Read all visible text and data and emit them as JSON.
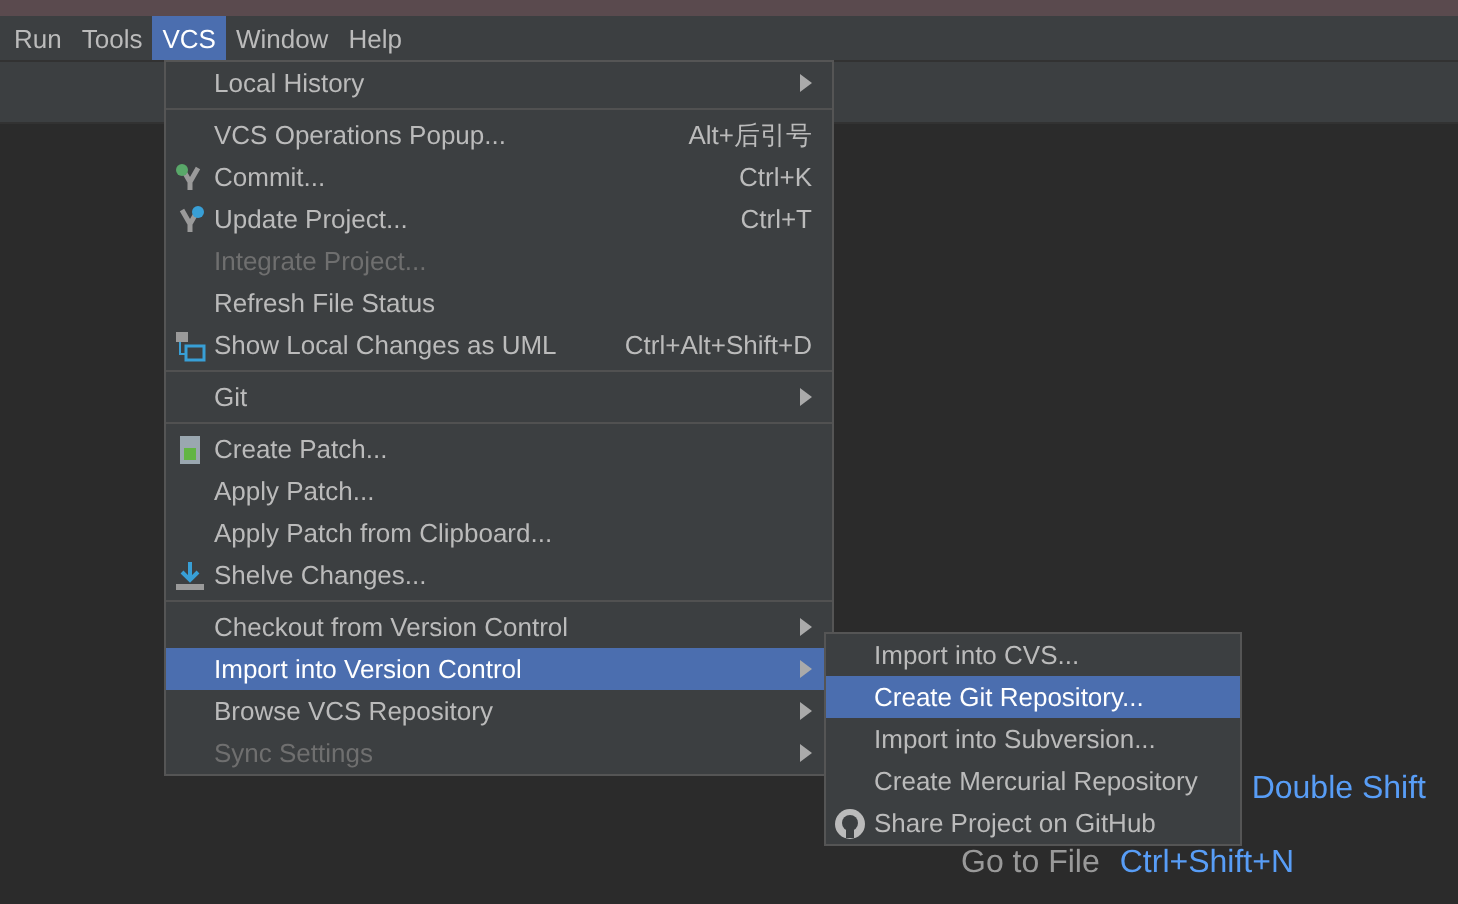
{
  "menubar": [
    {
      "label": "Run",
      "selected": false
    },
    {
      "label": "Tools",
      "selected": false
    },
    {
      "label": "VCS",
      "selected": true
    },
    {
      "label": "Window",
      "selected": false
    },
    {
      "label": "Help",
      "selected": false
    }
  ],
  "menu": [
    {
      "kind": "item",
      "label": "Local History",
      "submenu": true,
      "disabled": false,
      "selected": false
    },
    {
      "kind": "separator"
    },
    {
      "kind": "item",
      "label": "VCS Operations Popup...",
      "shortcut": "Alt+后引号",
      "disabled": false,
      "selected": false
    },
    {
      "kind": "item",
      "label": "Commit...",
      "shortcut": "Ctrl+K",
      "disabled": false,
      "selected": false
    },
    {
      "kind": "item",
      "label": "Update Project...",
      "shortcut": "Ctrl+T",
      "disabled": false,
      "selected": false
    },
    {
      "kind": "item",
      "label": "Integrate Project...",
      "disabled": true,
      "selected": false
    },
    {
      "kind": "item",
      "label": "Refresh File Status",
      "disabled": false,
      "selected": false
    },
    {
      "kind": "item",
      "label": "Show Local Changes as UML",
      "shortcut": "Ctrl+Alt+Shift+D",
      "disabled": false,
      "selected": false
    },
    {
      "kind": "separator"
    },
    {
      "kind": "item",
      "label": "Git",
      "submenu": true,
      "disabled": false,
      "selected": false
    },
    {
      "kind": "separator"
    },
    {
      "kind": "item",
      "label": "Create Patch...",
      "disabled": false,
      "selected": false
    },
    {
      "kind": "item",
      "label": "Apply Patch...",
      "disabled": false,
      "selected": false
    },
    {
      "kind": "item",
      "label": "Apply Patch from Clipboard...",
      "disabled": false,
      "selected": false
    },
    {
      "kind": "item",
      "label": "Shelve Changes...",
      "disabled": false,
      "selected": false
    },
    {
      "kind": "separator"
    },
    {
      "kind": "item",
      "label": "Checkout from Version Control",
      "submenu": true,
      "disabled": false,
      "selected": false
    },
    {
      "kind": "item",
      "label": "Import into Version Control",
      "submenu": true,
      "disabled": false,
      "selected": true
    },
    {
      "kind": "item",
      "label": "Browse VCS Repository",
      "submenu": true,
      "disabled": false,
      "selected": false
    },
    {
      "kind": "item",
      "label": "Sync Settings",
      "submenu": true,
      "disabled": true,
      "selected": false
    }
  ],
  "submenu": [
    {
      "label": "Import into CVS...",
      "selected": false
    },
    {
      "label": "Create Git Repository...",
      "selected": true
    },
    {
      "label": "Import into Subversion...",
      "selected": false
    },
    {
      "label": "Create Mercurial Repository",
      "selected": false
    },
    {
      "label": "Share Project on GitHub",
      "selected": false
    }
  ],
  "hints": [
    {
      "label": "Double Shift"
    },
    {
      "label": "Go to File",
      "shortcut": "Ctrl+Shift+N"
    }
  ]
}
